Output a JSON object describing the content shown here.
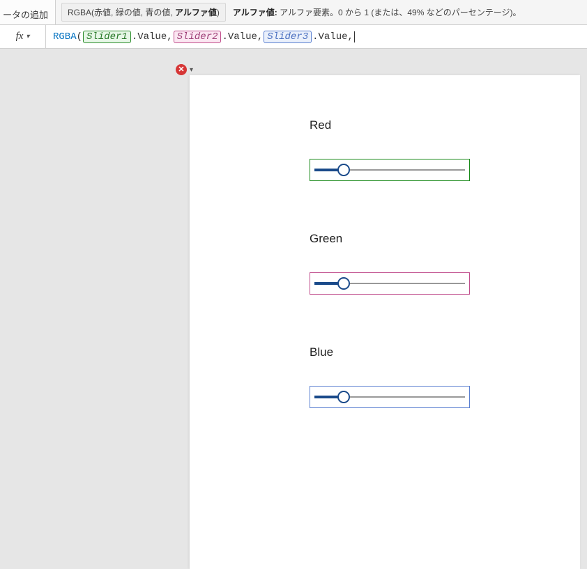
{
  "topbar": {
    "tab_label": "ータの追加",
    "signature_prefix": "RGBA(赤値, 緑の値, 青の値, ",
    "signature_bold": "アルファ値",
    "signature_suffix": ")",
    "desc_bold": "アルファ値:",
    "desc_text": " アルファ要素。0 から 1 (または、49% などのパーセンテージ)。"
  },
  "formula": {
    "fx_label": "fx",
    "fn": "RGBA",
    "open": "( ",
    "slider1": "Slider1",
    "dot_value1": ".Value",
    "comma": ", ",
    "slider2": "Slider2",
    "dot_value2": ".Value",
    "slider3": "Slider3",
    "dot_value3": ".Value",
    "trailing": ","
  },
  "error": {
    "glyph": "✕"
  },
  "canvas": {
    "red_label": "Red",
    "green_label": "Green",
    "blue_label": "Blue",
    "slider_values": {
      "red": 45,
      "green": 45,
      "blue": 45
    },
    "slider_max": 255
  }
}
